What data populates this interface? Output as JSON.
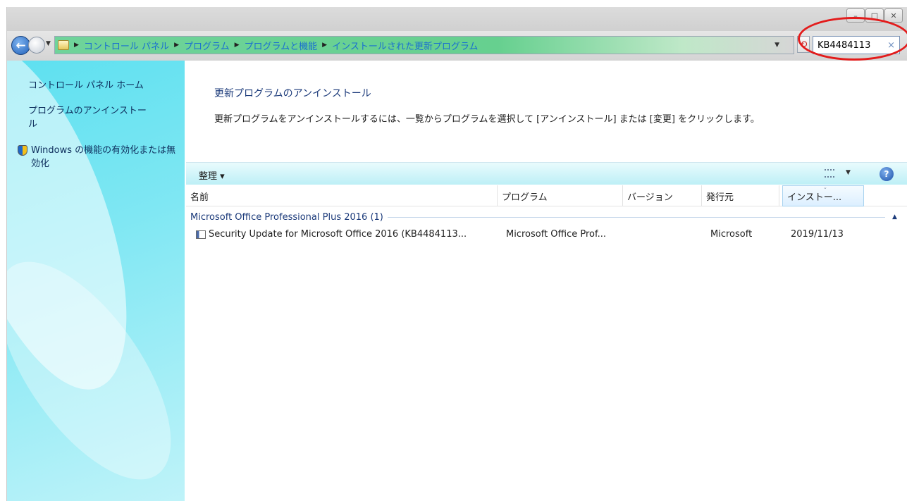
{
  "window": {
    "controls": [
      "–",
      "□",
      "✕"
    ]
  },
  "address": {
    "breadcrumbs": [
      "コントロール パネル",
      "プログラム",
      "プログラムと機能",
      "インストールされた更新プログラム"
    ],
    "search_value": "KB4484113",
    "search_clear": "×"
  },
  "sidebar": {
    "home_link": "コントロール パネル ホーム",
    "uninstall_link": "プログラムのアンインストール",
    "features_link": "Windows の機能の有効化または無効化"
  },
  "main": {
    "title": "更新プログラムのアンインストール",
    "description": "更新プログラムをアンインストールするには、一覧からプログラムを選択して [アンインストール] または [変更] をクリックします。"
  },
  "toolbar": {
    "organize_label": "整理 ▾"
  },
  "columns": {
    "name": "名前",
    "program": "プログラム",
    "version": "バージョン",
    "publisher": "発行元",
    "installed": "インストー..."
  },
  "group": {
    "label": "Microsoft Office Professional Plus 2016 (1)"
  },
  "rows": [
    {
      "name": "Security Update for Microsoft Office 2016 (KB4484113...",
      "program": "Microsoft Office Prof...",
      "version": "",
      "publisher": "Microsoft",
      "installed": "2019/11/13"
    }
  ],
  "colors": {
    "highlight": "#e31b1b",
    "sidebar": "#5ee0f0",
    "breadcrumb": "#6fd39a",
    "link": "#1b3a7a"
  },
  "icons": [
    "back-arrow-icon",
    "forward-arrow-icon",
    "folder-icon",
    "refresh-icon",
    "shield-icon",
    "view-icon",
    "help-icon",
    "update-icon"
  ]
}
